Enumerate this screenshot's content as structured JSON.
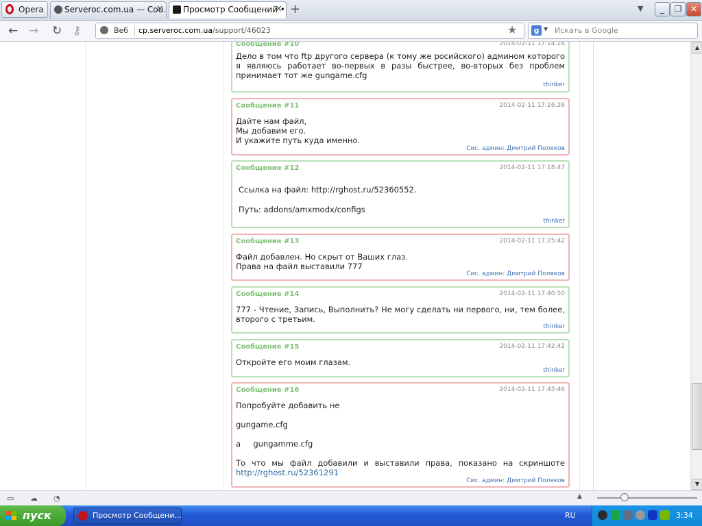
{
  "browser": {
    "menu_label": "Opera",
    "tabs": [
      {
        "title": "Serveroc.com.ua — Cou…"
      },
      {
        "title": "Просмотр Сообщений • …"
      }
    ],
    "address": {
      "scheme_label": "Веб",
      "url_host": "cp.serveroc.com.ua",
      "url_path": "/support/46023"
    },
    "search": {
      "engine_badge": "g",
      "placeholder": "Искать в Google"
    }
  },
  "messages": [
    {
      "title": "Сообщение #10",
      "date": "2014-02-11 17:14:24",
      "author": "thinker",
      "admin": false,
      "body": "Дело в том что ftp другого сервера (к тому же росийского) админом которого я являюсь работает во-первых в разы быстрее, во-вторых без проблем принимает тот же gungame.cfg"
    },
    {
      "title": "Сообщение #11",
      "date": "2014-02-11 17:16:26",
      "author": "Сис. админ: Дмитрий Поляков",
      "admin": true,
      "lines": [
        "Дайте нам файл,",
        "Мы добавим его.",
        "И укажите путь куда именно."
      ]
    },
    {
      "title": "Сообщение #12",
      "date": "2014-02-11 17:18:47",
      "author": "thinker",
      "admin": false,
      "lines": [
        "Ссылка на файл: http://rghost.ru/52360552.",
        "Путь: addons/amxmodx/configs"
      ]
    },
    {
      "title": "Сообщение #13",
      "date": "2014-02-11 17:25:42",
      "author": "Сис. админ: Дмитрий Поляков",
      "admin": true,
      "lines": [
        "Файл добавлен. Но скрыт от Ваших глаз.",
        "Права на файл выставили 777"
      ]
    },
    {
      "title": "Сообщение #14",
      "date": "2014-02-11 17:40:50",
      "author": "thinker",
      "admin": false,
      "body": "777 - Чтение, Запись, Выполнить? Не могу сделать ни первого, ни, тем более, второго с третьим."
    },
    {
      "title": "Сообщение #15",
      "date": "2014-02-11 17:42:42",
      "author": "thinker",
      "admin": false,
      "body": "Откройте его моим глазам."
    },
    {
      "title": "Сообщение #16",
      "date": "2014-02-11 17:45:46",
      "author": "Сис. админ: Дмитрий Поляков",
      "admin": true,
      "lines": [
        "Попробуйте добавить не",
        "gungame.cfg",
        "а     gungamme.cfg"
      ],
      "text": "То что мы файл добавили и выставили права, показано на скриншоте",
      "link": "http://rghost.ru/52361291"
    }
  ],
  "taskbar": {
    "start_label": "пуск",
    "task_title": "Просмотр Сообщени...",
    "lang": "RU",
    "clock": "3:34"
  }
}
